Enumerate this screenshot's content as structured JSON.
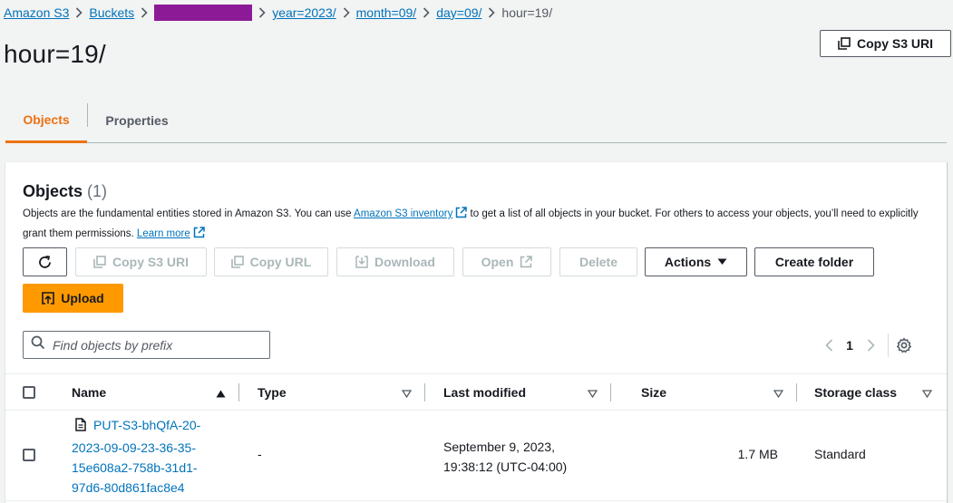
{
  "breadcrumb": {
    "amazon_s3": "Amazon S3",
    "buckets": "Buckets",
    "year": "year=2023/",
    "month": "month=09/",
    "day": "day=09/",
    "current": "hour=19/"
  },
  "page_title": "hour=19/",
  "header": {
    "copy_uri_label": "Copy S3 URI"
  },
  "tabs": [
    {
      "label": "Objects",
      "active": true
    },
    {
      "label": "Properties",
      "active": false
    }
  ],
  "objects_panel": {
    "title": "Objects",
    "count": "(1)",
    "desc_before": "Objects are the fundamental entities stored in Amazon S3. You can use ",
    "inventory_link": "Amazon S3 inventory",
    "desc_after": " to get a list of all objects in your bucket. For others to access your objects, you’ll need to explicitly grant them permissions. ",
    "learn_more": "Learn more"
  },
  "toolbar": {
    "copy_uri": "Copy S3 URI",
    "copy_url": "Copy URL",
    "download": "Download",
    "open": "Open",
    "delete": "Delete",
    "actions": "Actions",
    "create_folder": "Create folder",
    "upload": "Upload"
  },
  "search": {
    "placeholder": "Find objects by prefix"
  },
  "pagination": {
    "current_page": "1"
  },
  "table": {
    "columns": [
      "Name",
      "Type",
      "Last modified",
      "Size",
      "Storage class"
    ],
    "rows": [
      {
        "name": "PUT-S3-bhQfA-20-2023-09-09-23-36-35-15e608a2-758b-31d1-97d6-80d861fac8e4",
        "name_lines": [
          "PUT-S3-bhQfA-20-",
          "2023-09-09-23-36-35-",
          "15e608a2-758b-31d1-",
          "97d6-80d861fac8e4"
        ],
        "type": "-",
        "last_modified_lines": [
          "September 9, 2023,",
          "19:38:12 (UTC-04:00)"
        ],
        "size": "1.7 MB",
        "storage_class": "Standard"
      }
    ]
  },
  "colors": {
    "link": "#0073bb",
    "accent": "#ec7211",
    "primary_button": "#ff9900",
    "redacted": "#8c1a96"
  }
}
